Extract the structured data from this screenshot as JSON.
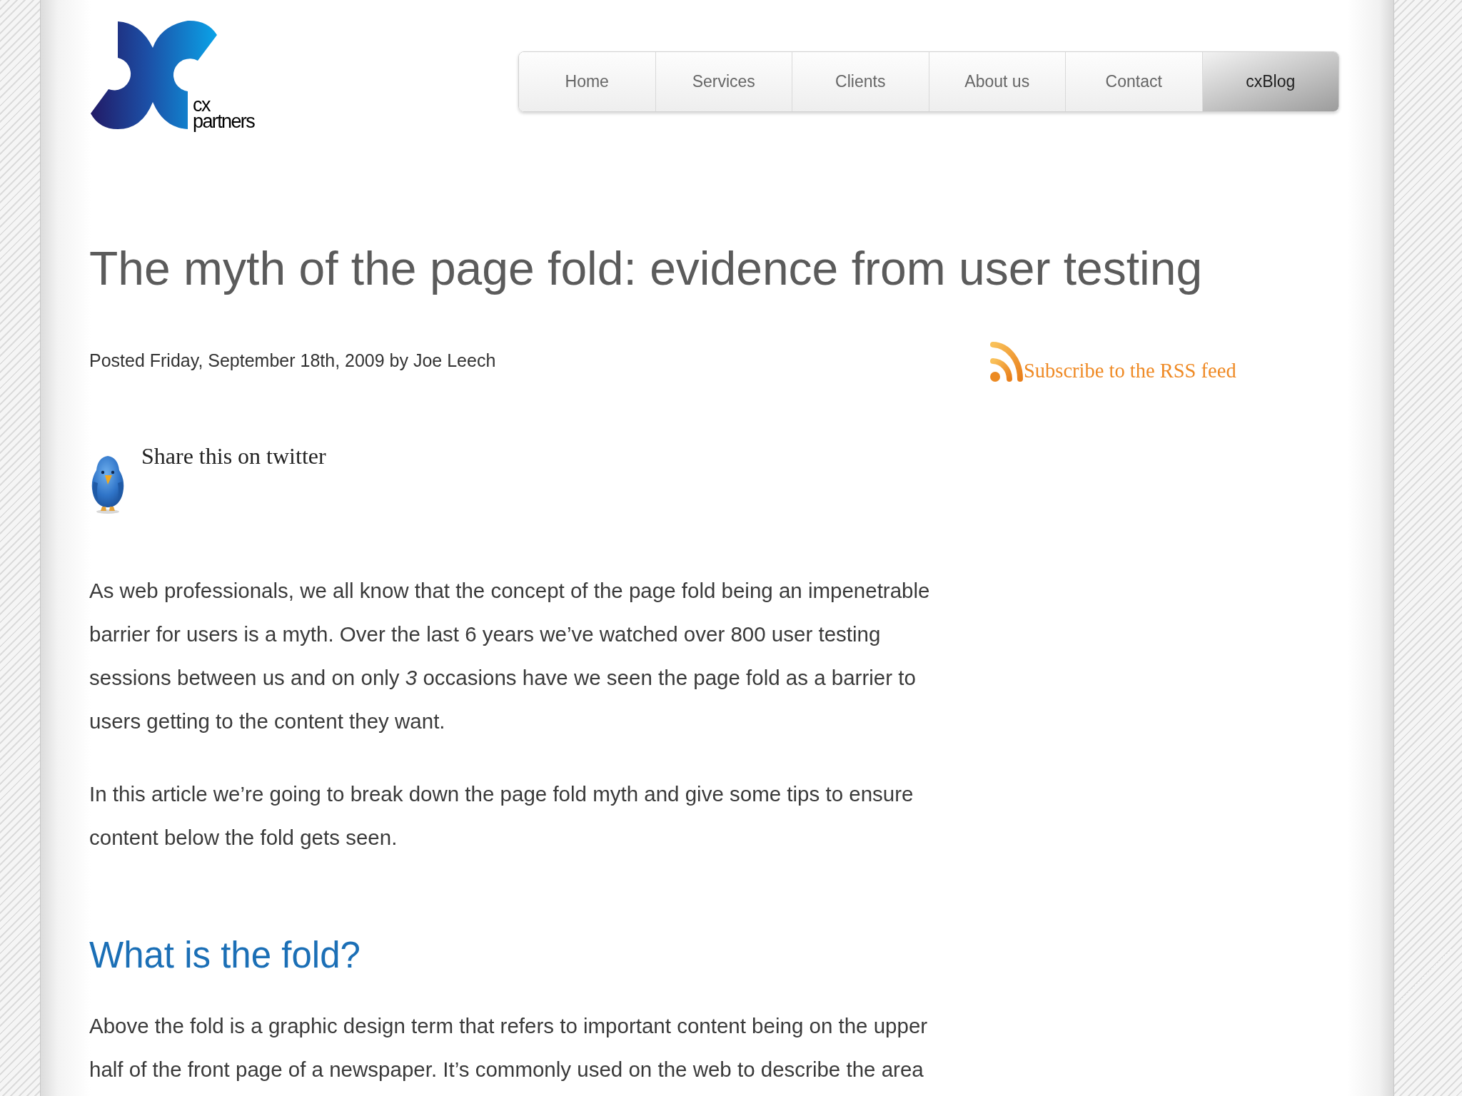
{
  "logo": {
    "lines": [
      "cx",
      "partners"
    ]
  },
  "nav": [
    {
      "label": "Home",
      "selected": false
    },
    {
      "label": "Services",
      "selected": false
    },
    {
      "label": "Clients",
      "selected": false
    },
    {
      "label": "About us",
      "selected": false
    },
    {
      "label": "Contact",
      "selected": false
    },
    {
      "label": "cxBlog",
      "selected": true
    }
  ],
  "article": {
    "title": "The myth of the page fold: evidence from user testing",
    "byline": "Posted Friday, September 18th, 2009 by Joe Leech",
    "rss_link": "Subscribe to the RSS feed",
    "share_link": "Share this on twitter",
    "blocks": [
      {
        "kind": "paragraph",
        "text": "As web professionals, we all know that the concept of the page fold being an impenetrable barrier for users is a myth. Over the last 6 years we’ve watched over 800 user testing sessions between us and on only *3* occasions have we seen the page fold as a barrier to users getting to the content they want."
      },
      {
        "kind": "paragraph",
        "text": "In this article we’re going to break down the page fold myth and give some tips to ensure content below the fold gets seen."
      },
      {
        "kind": "heading",
        "text": "What is the fold?"
      },
      {
        "kind": "paragraph",
        "text": "Above the fold is a graphic design term that refers to important content being on the upper half of the front page of a newspaper. It’s commonly used on the web to describe the area"
      }
    ]
  }
}
